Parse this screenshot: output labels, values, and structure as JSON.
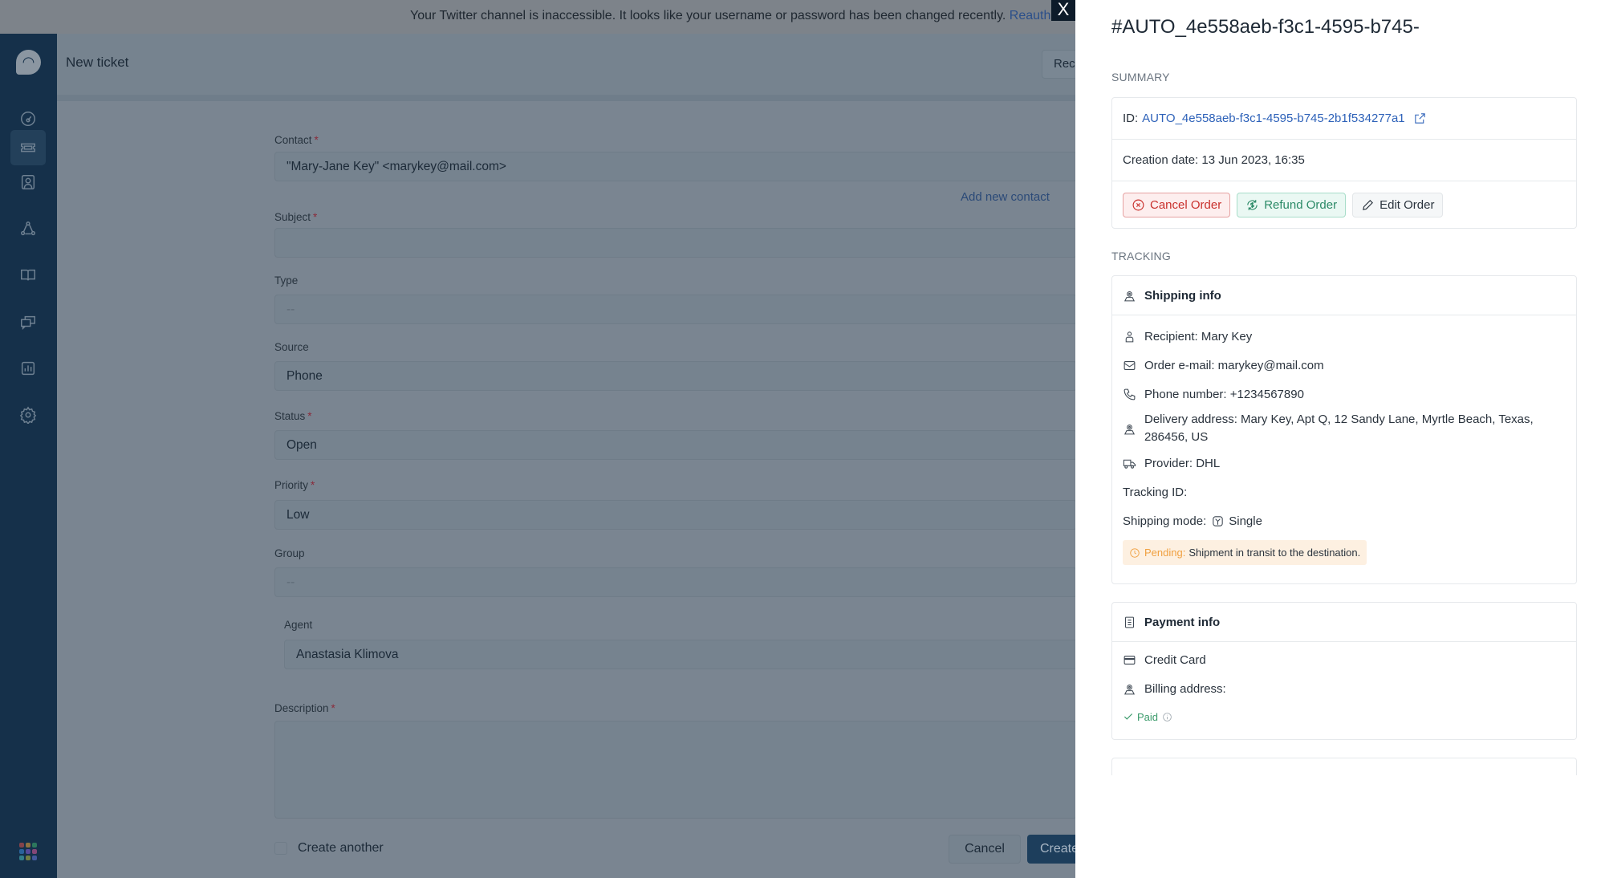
{
  "banner": {
    "message": "Your Twitter channel is inaccessible. It looks like your username or password has been changed recently.",
    "link": "Reauthorize",
    "close": "X"
  },
  "sidebar": {
    "logo_icon": "headset-icon",
    "items": [
      {
        "name": "dashboard",
        "icon": "gauge-icon"
      },
      {
        "name": "tickets",
        "icon": "ticket-icon",
        "active": true
      },
      {
        "name": "contacts",
        "icon": "contact-icon"
      },
      {
        "name": "groups",
        "icon": "network-icon"
      },
      {
        "name": "knowledge-base",
        "icon": "book-icon"
      },
      {
        "name": "conversations",
        "icon": "chat-icon"
      },
      {
        "name": "reports",
        "icon": "chart-icon"
      },
      {
        "name": "settings",
        "icon": "gear-icon"
      }
    ],
    "apps_colors": [
      "#e0544b",
      "#f2a93b",
      "#3fb36e",
      "#3b8ee0",
      "#8b5ee0",
      "#e05b9d",
      "#4ac0c0",
      "#c0c040",
      "#6a7be0"
    ]
  },
  "header": {
    "title": "New ticket",
    "right_button": "Recent"
  },
  "form": {
    "contact": {
      "label": "Contact",
      "value": "\"Mary-Jane Key\" <marykey@mail.com>"
    },
    "add_contact": "Add new contact",
    "subject": {
      "label": "Subject",
      "value": ""
    },
    "type": {
      "label": "Type",
      "value": "--"
    },
    "source": {
      "label": "Source",
      "value": "Phone"
    },
    "status": {
      "label": "Status",
      "value": "Open"
    },
    "priority": {
      "label": "Priority",
      "value": "Low"
    },
    "group": {
      "label": "Group",
      "value": "--"
    },
    "agent": {
      "label": "Agent",
      "value": "Anastasia Klimova"
    },
    "description": {
      "label": "Description",
      "value": ""
    },
    "required_mark": "*",
    "create_another": "Create another",
    "cancel": "Cancel",
    "create": "Create"
  },
  "panel": {
    "title": "#AUTO_4e558aeb-f3c1-4595-b745-",
    "summary_heading": "SUMMARY",
    "id_label": "ID:",
    "id_value": "AUTO_4e558aeb-f3c1-4595-b745-2b1f534277a1",
    "creation_date": "Creation date: 13 Jun 2023, 16:35",
    "buttons": {
      "cancel": "Cancel Order",
      "refund": "Refund Order",
      "edit": "Edit Order"
    },
    "tracking_heading": "TRACKING",
    "shipping": {
      "title": "Shipping info",
      "recipient": "Recipient: Mary Key",
      "email": "Order e-mail: marykey@mail.com",
      "phone": "Phone number: +1234567890",
      "address": "Delivery address: Mary Key, Apt Q, 12 Sandy Lane, Myrtle Beach, Texas, 286456, US",
      "provider": "Provider: DHL",
      "tracking_id": "Tracking ID:",
      "mode_label": "Shipping mode:",
      "mode_value": "Single",
      "status_label": "Pending:",
      "status_text": "Shipment in transit to the destination."
    },
    "payment": {
      "title": "Payment info",
      "method": "Credit Card",
      "billing": "Billing address:",
      "paid": "Paid"
    },
    "colors": {
      "link": "#2e62b9",
      "danger": "#c9302c",
      "success": "#2b8a67",
      "pending": "#f0a040"
    }
  }
}
